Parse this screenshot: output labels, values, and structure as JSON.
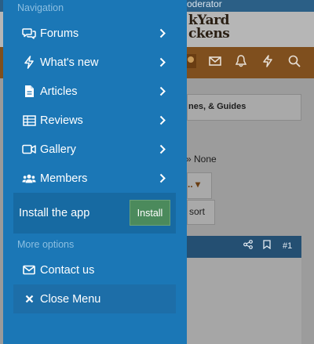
{
  "background": {
    "topbar_text": "oderator",
    "logo_line1": "kYard",
    "logo_line2": "ckens",
    "section_title": "nes, & Guides",
    "filter_none": "None",
    "sort_label": "sort",
    "post_number": "#1"
  },
  "drawer": {
    "navigation_heading": "Navigation",
    "items": [
      {
        "label": "Forums",
        "icon": "comments-icon"
      },
      {
        "label": "What's new",
        "icon": "bolt-icon"
      },
      {
        "label": "Articles",
        "icon": "file-icon"
      },
      {
        "label": "Reviews",
        "icon": "table-icon"
      },
      {
        "label": "Gallery",
        "icon": "video-icon"
      },
      {
        "label": "Members",
        "icon": "users-icon"
      }
    ],
    "install_label": "Install the app",
    "install_button": "Install",
    "more_options_heading": "More options",
    "contact_label": "Contact us",
    "close_label": "Close Menu"
  },
  "colors": {
    "drawer_bg": "#1b77b6",
    "install_button_bg": "#4b8a5c",
    "heading_text": "#8cbfe1"
  }
}
